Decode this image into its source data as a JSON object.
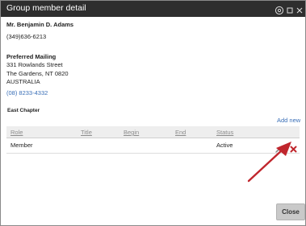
{
  "window": {
    "title": "Group member detail",
    "icons": [
      "help-icon",
      "maximize-icon",
      "close-icon"
    ]
  },
  "member": {
    "name": "Mr. Benjamin D. Adams",
    "phone": "(349)636-6213",
    "mailing_label": "Preferred Mailing",
    "address_line1": "331 Rowlands Street",
    "address_line2": "The Gardens, NT 0820",
    "address_country": "AUSTRALIA",
    "mailing_phone": "(08) 8233-4332"
  },
  "chapter": {
    "name": "East Chapter",
    "add_new_label": "Add new"
  },
  "table": {
    "headers": [
      "Role",
      "Title",
      "Begin",
      "End",
      "Status"
    ],
    "rows": [
      {
        "role": "Member",
        "title": "",
        "begin": "",
        "end": "",
        "status": "Active"
      }
    ]
  },
  "footer": {
    "close_label": "Close"
  },
  "colors": {
    "titlebar": "#2e2e2e",
    "link": "#3a6fb7",
    "delete": "#c0262d",
    "arrow": "#c0262d"
  }
}
